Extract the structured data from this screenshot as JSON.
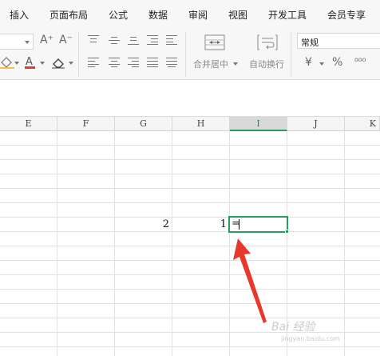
{
  "menu": {
    "items": [
      {
        "label": "插入"
      },
      {
        "label": "页面布局"
      },
      {
        "label": "公式"
      },
      {
        "label": "数据"
      },
      {
        "label": "审阅"
      },
      {
        "label": "视图"
      },
      {
        "label": "开发工具"
      },
      {
        "label": "会员专享"
      }
    ]
  },
  "ribbon": {
    "font_grow": "A⁺",
    "font_shrink": "A⁻",
    "merge_label": "合并居中",
    "wrap_label": "自动换行",
    "number_format": "常规",
    "currency_symbol": "¥",
    "percent_symbol": "%",
    "comma_symbol": "⁰⁰⁰"
  },
  "columns": [
    "E",
    "F",
    "G",
    "H",
    "I",
    "J",
    "K"
  ],
  "selected_column": "I",
  "cells": {
    "g_value": "2",
    "h_value": "1",
    "active_input": "="
  },
  "watermark": {
    "text": "Bai 经验",
    "sub": "jingyan.baidu.com"
  },
  "colors": {
    "accent": "#2a9d5c",
    "arrow": "#e8382b"
  }
}
